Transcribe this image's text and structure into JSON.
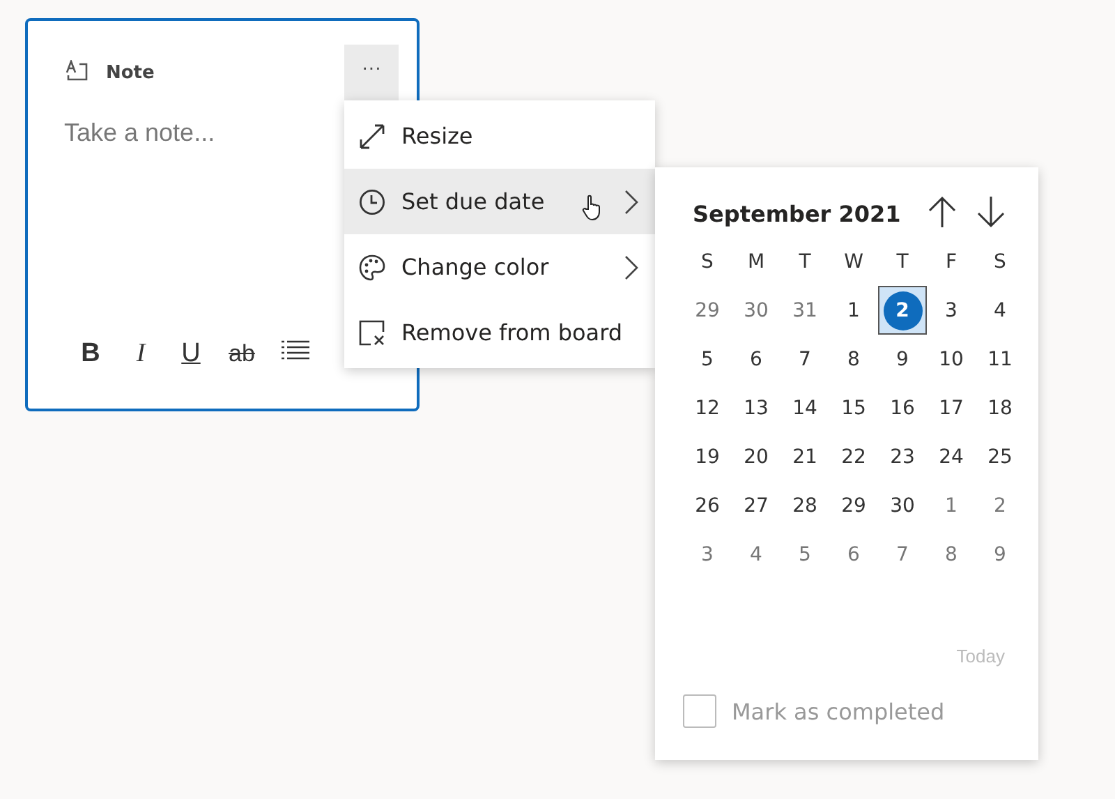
{
  "note": {
    "title": "Note",
    "placeholder": "Take a note...",
    "more_button": "···",
    "toolbar": [
      {
        "kind": "bold",
        "text": "B"
      },
      {
        "kind": "italic",
        "text": "I"
      },
      {
        "kind": "underline",
        "text": "U"
      },
      {
        "kind": "strike",
        "text": "ab"
      },
      {
        "kind": "list"
      }
    ]
  },
  "menu": {
    "items": [
      {
        "kind": "resize",
        "label": "Resize",
        "selected": false,
        "submenu": false
      },
      {
        "kind": "clock",
        "label": "Set due date",
        "selected": true,
        "submenu": true
      },
      {
        "kind": "palette",
        "label": "Change color",
        "selected": false,
        "submenu": true
      },
      {
        "kind": "remove",
        "label": "Remove from board",
        "selected": false,
        "submenu": false
      }
    ]
  },
  "calendar": {
    "title": "September 2021",
    "weekdays": [
      "S",
      "M",
      "T",
      "W",
      "T",
      "F",
      "S"
    ],
    "weeks": [
      [
        {
          "text": "29",
          "in_month": false,
          "selected": false
        },
        {
          "text": "30",
          "in_month": false,
          "selected": false
        },
        {
          "text": "31",
          "in_month": false,
          "selected": false
        },
        {
          "text": "1",
          "in_month": true,
          "selected": false
        },
        {
          "text": "2",
          "in_month": true,
          "selected": true
        },
        {
          "text": "3",
          "in_month": true,
          "selected": false
        },
        {
          "text": "4",
          "in_month": true,
          "selected": false
        }
      ],
      [
        {
          "text": "5",
          "in_month": true,
          "selected": false
        },
        {
          "text": "6",
          "in_month": true,
          "selected": false
        },
        {
          "text": "7",
          "in_month": true,
          "selected": false
        },
        {
          "text": "8",
          "in_month": true,
          "selected": false
        },
        {
          "text": "9",
          "in_month": true,
          "selected": false
        },
        {
          "text": "10",
          "in_month": true,
          "selected": false
        },
        {
          "text": "11",
          "in_month": true,
          "selected": false
        }
      ],
      [
        {
          "text": "12",
          "in_month": true,
          "selected": false
        },
        {
          "text": "13",
          "in_month": true,
          "selected": false
        },
        {
          "text": "14",
          "in_month": true,
          "selected": false
        },
        {
          "text": "15",
          "in_month": true,
          "selected": false
        },
        {
          "text": "16",
          "in_month": true,
          "selected": false
        },
        {
          "text": "17",
          "in_month": true,
          "selected": false
        },
        {
          "text": "18",
          "in_month": true,
          "selected": false
        }
      ],
      [
        {
          "text": "19",
          "in_month": true,
          "selected": false
        },
        {
          "text": "20",
          "in_month": true,
          "selected": false
        },
        {
          "text": "21",
          "in_month": true,
          "selected": false
        },
        {
          "text": "22",
          "in_month": true,
          "selected": false
        },
        {
          "text": "23",
          "in_month": true,
          "selected": false
        },
        {
          "text": "24",
          "in_month": true,
          "selected": false
        },
        {
          "text": "25",
          "in_month": true,
          "selected": false
        }
      ],
      [
        {
          "text": "26",
          "in_month": true,
          "selected": false
        },
        {
          "text": "27",
          "in_month": true,
          "selected": false
        },
        {
          "text": "28",
          "in_month": true,
          "selected": false
        },
        {
          "text": "29",
          "in_month": true,
          "selected": false
        },
        {
          "text": "30",
          "in_month": true,
          "selected": false
        },
        {
          "text": "1",
          "in_month": false,
          "selected": false
        },
        {
          "text": "2",
          "in_month": false,
          "selected": false
        }
      ],
      [
        {
          "text": "3",
          "in_month": false,
          "selected": false
        },
        {
          "text": "4",
          "in_month": false,
          "selected": false
        },
        {
          "text": "5",
          "in_month": false,
          "selected": false
        },
        {
          "text": "6",
          "in_month": false,
          "selected": false
        },
        {
          "text": "7",
          "in_month": false,
          "selected": false
        },
        {
          "text": "8",
          "in_month": false,
          "selected": false
        },
        {
          "text": "9",
          "in_month": false,
          "selected": false
        }
      ]
    ],
    "today": {
      "label": "Today",
      "disabled": true
    },
    "mark_completed": {
      "label": "Mark as completed",
      "checked": false,
      "disabled": true
    }
  }
}
